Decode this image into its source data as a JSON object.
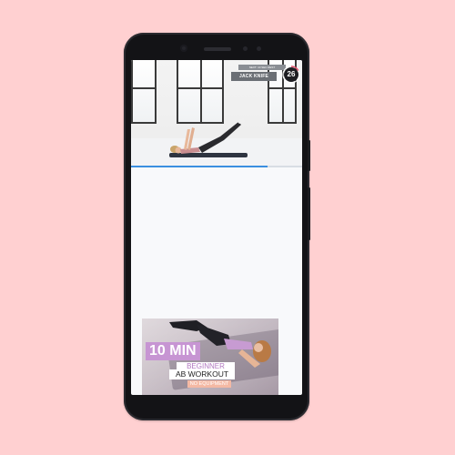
{
  "background_color": "#ffd0d1",
  "video": {
    "next_text": "NEXT: 10 SEC REST",
    "exercise_name": "JACK KNIFE",
    "timer_value": "26",
    "progress": 0.8,
    "accent_color": "#3b8fe0"
  },
  "thumbnail": {
    "duration": "10 MIN",
    "level": "BEGINNER",
    "title": "AB WORKOUT",
    "subtitle": "NO EQUIPMENT",
    "accent_color": "#c795d3"
  }
}
